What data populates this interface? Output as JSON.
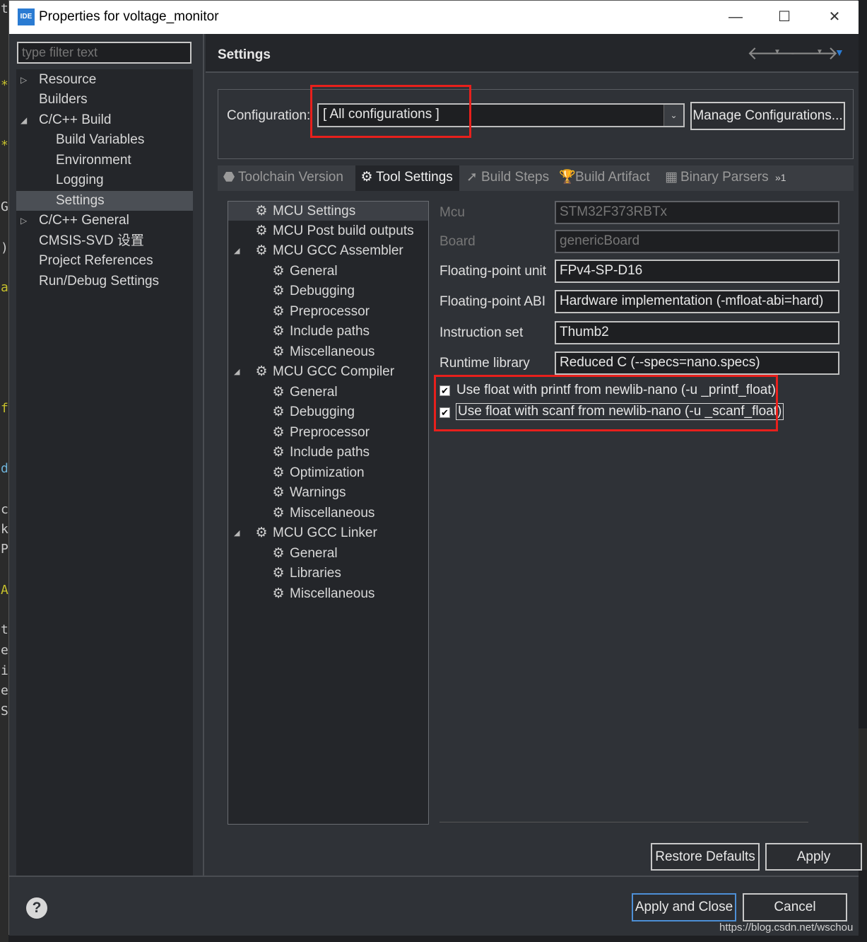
{
  "window": {
    "title": "Properties for voltage_monitor",
    "icon_label": "IDE",
    "minimize_glyph": "—",
    "maximize_glyph": "☐",
    "close_glyph": "✕"
  },
  "filter": {
    "placeholder": "type filter text"
  },
  "nav": {
    "items": [
      {
        "label": "Resource"
      },
      {
        "label": "Builders"
      },
      {
        "label": "C/C++ Build"
      },
      {
        "label": "Build Variables"
      },
      {
        "label": "Environment"
      },
      {
        "label": "Logging"
      },
      {
        "label": "Settings"
      },
      {
        "label": "C/C++ General"
      },
      {
        "label": "CMSIS-SVD 设置"
      },
      {
        "label": "Project References"
      },
      {
        "label": "Run/Debug Settings"
      }
    ]
  },
  "header": {
    "title": "Settings"
  },
  "config": {
    "label": "Configuration:",
    "value": "[ All configurations ]",
    "manage_label": "Manage Configurations..."
  },
  "tabs": [
    {
      "label": "Toolchain  Version",
      "icon": "toolchain-icon"
    },
    {
      "label": "Tool Settings",
      "icon": "gear-icon"
    },
    {
      "label": "Build Steps",
      "icon": "build-steps-icon"
    },
    {
      "label": "Build Artifact",
      "icon": "trophy-icon"
    },
    {
      "label": "Binary Parsers",
      "icon": "binary-parser-icon"
    },
    {
      "label": "»1",
      "icon": "overflow-icon"
    }
  ],
  "tree": [
    {
      "label": "MCU Settings"
    },
    {
      "label": "MCU Post build outputs"
    },
    {
      "label": "MCU GCC Assembler"
    },
    {
      "label": "General"
    },
    {
      "label": "Debugging"
    },
    {
      "label": "Preprocessor"
    },
    {
      "label": "Include paths"
    },
    {
      "label": "Miscellaneous"
    },
    {
      "label": "MCU GCC Compiler"
    },
    {
      "label": "General"
    },
    {
      "label": "Debugging"
    },
    {
      "label": "Preprocessor"
    },
    {
      "label": "Include paths"
    },
    {
      "label": "Optimization"
    },
    {
      "label": "Warnings"
    },
    {
      "label": "Miscellaneous"
    },
    {
      "label": "MCU GCC Linker"
    },
    {
      "label": "General"
    },
    {
      "label": "Libraries"
    },
    {
      "label": "Miscellaneous"
    }
  ],
  "props": [
    {
      "label": "Mcu",
      "value": "STM32F373RBTx"
    },
    {
      "label": "Board",
      "value": "genericBoard"
    },
    {
      "label": "Floating-point unit",
      "value": "FPv4-SP-D16"
    },
    {
      "label": "Floating-point ABI",
      "value": "Hardware implementation (-mfloat-abi=hard)"
    },
    {
      "label": "Instruction set",
      "value": "Thumb2"
    },
    {
      "label": "Runtime library",
      "value": "Reduced C (--specs=nano.specs)"
    }
  ],
  "checks": [
    {
      "label": "Use float with printf from newlib-nano (-u _printf_float)",
      "checked": true
    },
    {
      "label": "Use float with scanf from newlib-nano (-u _scanf_float)",
      "checked": true
    }
  ],
  "buttons": {
    "restore": "Restore Defaults",
    "apply": "Apply",
    "apply_close": "Apply and Close",
    "cancel": "Cancel",
    "help": "?"
  },
  "watermark": "https://blog.csdn.net/wschou",
  "background": {
    "chars": [
      "t",
      "*",
      "*",
      "G",
      ")",
      "a",
      "f",
      "d",
      "c",
      "k",
      "P",
      "A",
      "t",
      "e",
      "i",
      "e",
      "S"
    ]
  },
  "colors": {
    "highlight": "#e8201c",
    "accent": "#2a7bd2"
  }
}
